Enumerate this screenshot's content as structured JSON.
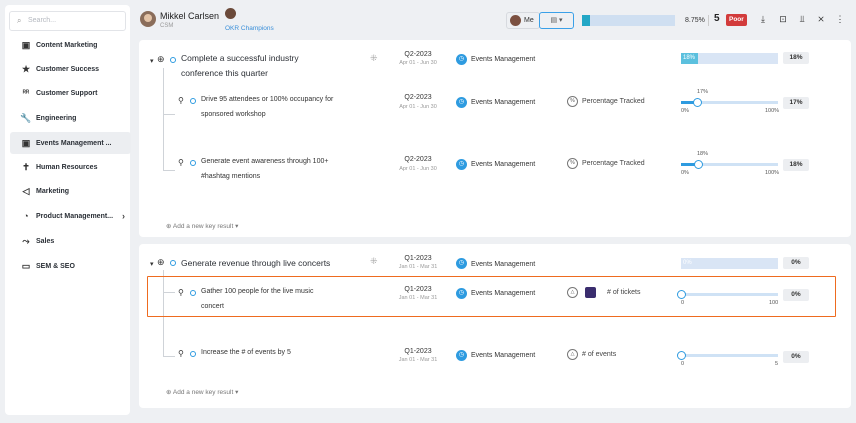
{
  "sidebar": {
    "search_placeholder": "Search...",
    "items": [
      {
        "label": "Content Marketing",
        "icon": "calendar-icon"
      },
      {
        "label": "Customer Success",
        "icon": "star-icon"
      },
      {
        "label": "Customer Support",
        "icon": "people-icon"
      },
      {
        "label": "Engineering",
        "icon": "wrench-icon"
      },
      {
        "label": "Events Management ...",
        "icon": "calendar-icon",
        "active": true
      },
      {
        "label": "Human Resources",
        "icon": "person-icon"
      },
      {
        "label": "Marketing",
        "icon": "megaphone-icon"
      },
      {
        "label": "Product Management...",
        "icon": "gauge-icon"
      },
      {
        "label": "Sales",
        "icon": "chart-line-icon"
      },
      {
        "label": "SEM & SEO",
        "icon": "monitor-icon"
      }
    ]
  },
  "header": {
    "owner_name": "Mikkel Carlsen",
    "owner_role": "CSM",
    "team_name": "OKR Champions",
    "me_label": "Me",
    "progress_value": 8.75,
    "progress_label": "8.75%",
    "score": "5",
    "score_label": "Poor",
    "colors": {
      "accent": "#2e9be0",
      "progress": "#23a7c6",
      "poor": "#d23b3b",
      "highlight": "#ee6b1f"
    }
  },
  "objectives": [
    {
      "title_line1": "Complete a successful industry",
      "title_line2": "conference this quarter",
      "quarter": "Q2-2023",
      "dates": "Apr 01 - Jun 30",
      "team": "Events Management",
      "progress_value": 18,
      "progress_label": "18%",
      "pct": "18%",
      "key_results": [
        {
          "title_line1": "Drive 95 attendees or 100% occupancy for",
          "title_line2": "sponsored workshop",
          "quarter": "Q2-2023",
          "dates": "Apr 01 - Jun 30",
          "team": "Events Management",
          "metric": "Percentage Tracked",
          "current": "17%",
          "current_value": 17,
          "min": "0%",
          "max": "100%",
          "pct": "17%"
        },
        {
          "title_line1": "Generate event awareness through 100+",
          "title_line2": "#hashtag mentions",
          "quarter": "Q2-2023",
          "dates": "Apr 01 - Jun 30",
          "team": "Events Management",
          "metric": "Percentage Tracked",
          "current": "18%",
          "current_value": 18,
          "min": "0%",
          "max": "100%",
          "pct": "18%"
        }
      ],
      "add_kr": "Add a new key result"
    },
    {
      "title_line1": "Generate revenue through live concerts",
      "title_line2": "",
      "quarter": "Q1-2023",
      "dates": "Jan 01 - Mar 31",
      "team": "Events Management",
      "progress_value": 0,
      "progress_label": "0%",
      "pct": "0%",
      "key_results": [
        {
          "title_line1": "Gather 100 people for the live music",
          "title_line2": "concert",
          "quarter": "Q1-2023",
          "dates": "Jan 01 - Mar 31",
          "team": "Events Management",
          "metric": "# of tickets",
          "current_value": 0,
          "min": "0",
          "max": "100",
          "pct": "0%"
        },
        {
          "title_line1": "Increase the # of events by 5",
          "title_line2": "",
          "quarter": "Q1-2023",
          "dates": "Jan 01 - Mar 31",
          "team": "Events Management",
          "metric": "# of events",
          "current_value": 0,
          "min": "0",
          "max": "5",
          "pct": "0%"
        }
      ],
      "add_kr": "Add a new key result"
    }
  ]
}
